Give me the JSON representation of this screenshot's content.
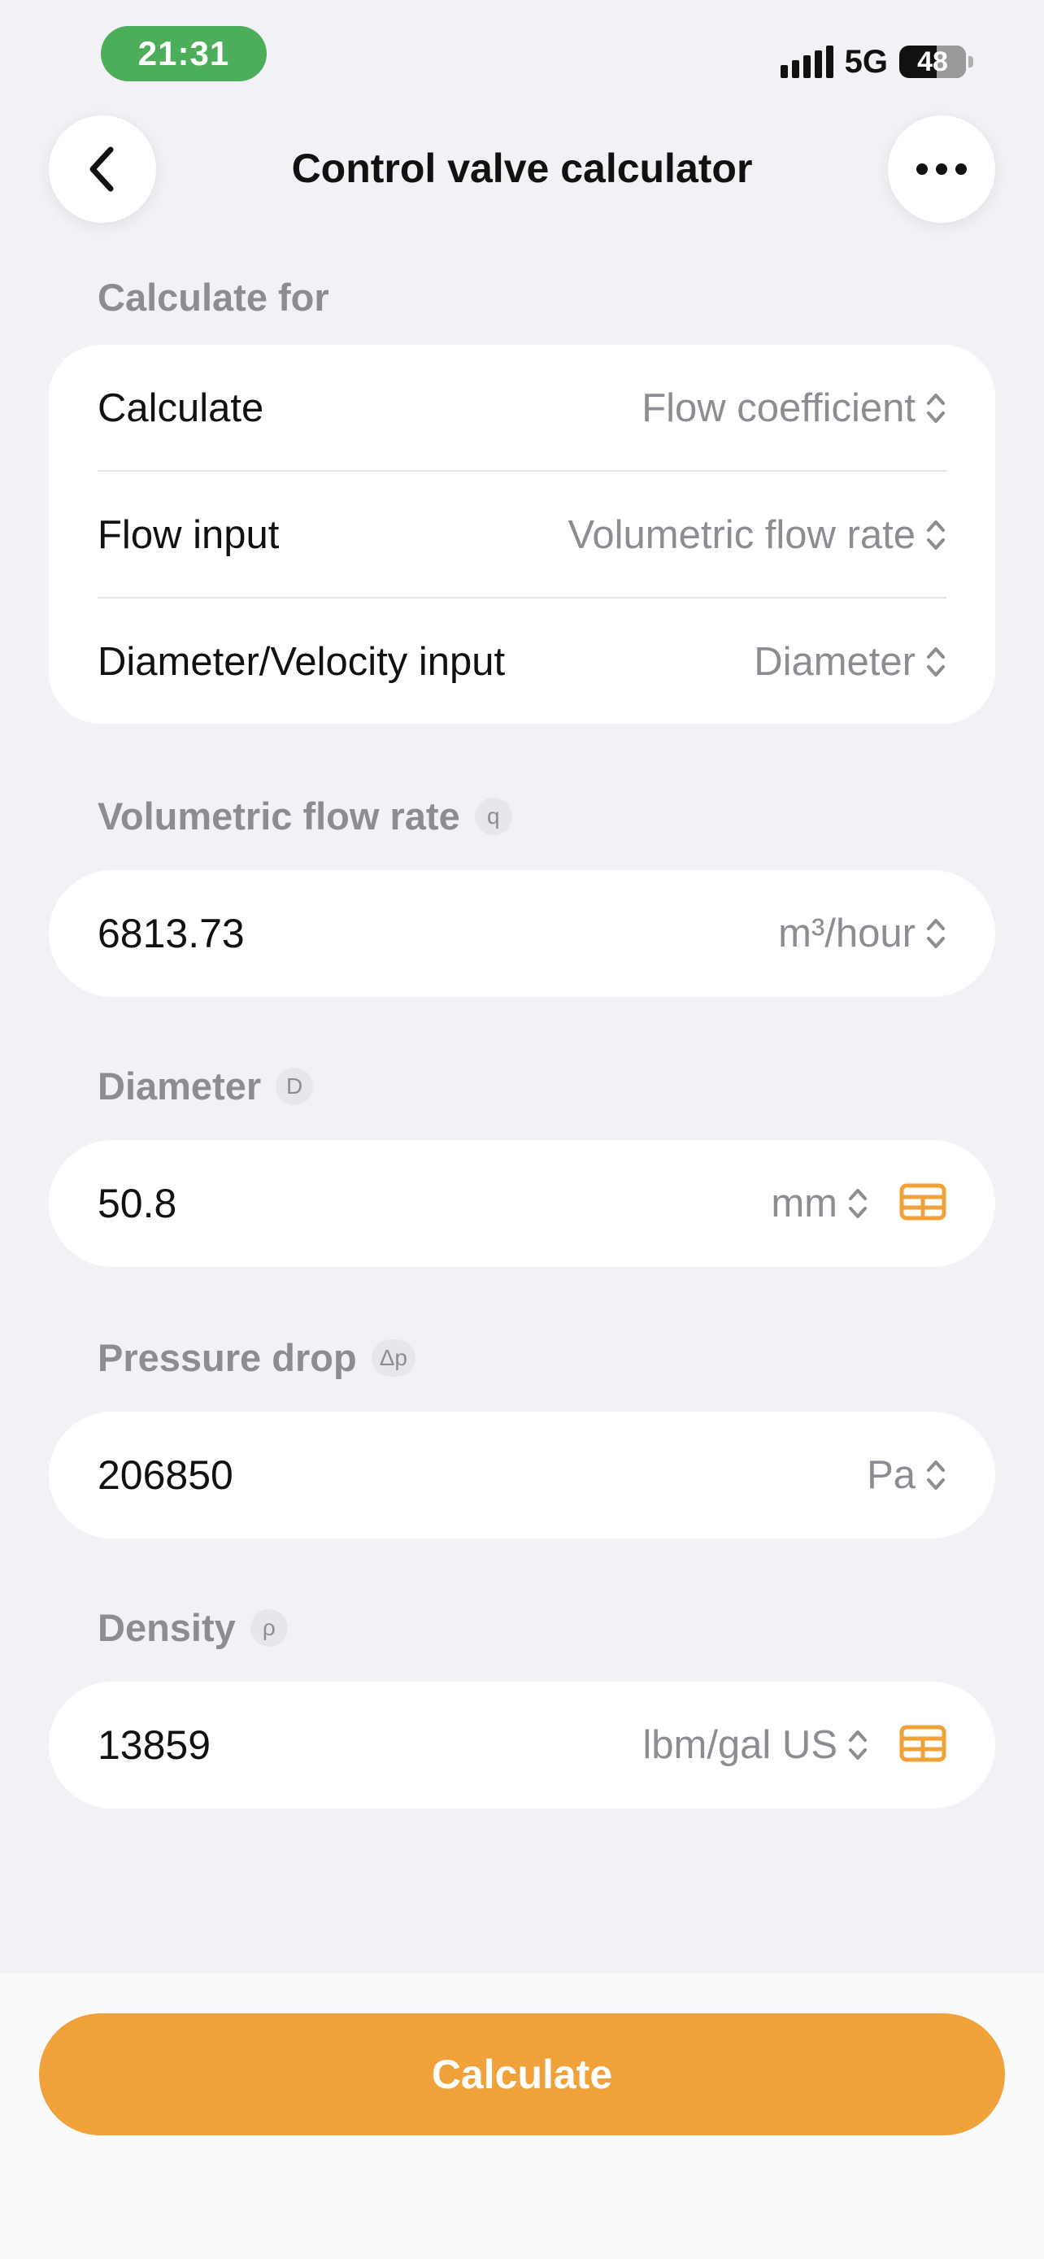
{
  "status_bar": {
    "time": "21:31",
    "network": "5G",
    "battery": "48"
  },
  "header": {
    "title": "Control valve calculator"
  },
  "calculate_for": {
    "label": "Calculate for",
    "rows": [
      {
        "label": "Calculate",
        "value": "Flow coefficient"
      },
      {
        "label": "Flow input",
        "value": "Volumetric flow rate"
      },
      {
        "label": "Diameter/Velocity input",
        "value": "Diameter"
      }
    ]
  },
  "fields": [
    {
      "label": "Volumetric flow rate",
      "symbol": "q",
      "value": "6813.73",
      "unit": "m³/hour",
      "has_table": false
    },
    {
      "label": "Diameter",
      "symbol": "D",
      "value": "50.8",
      "unit": "mm",
      "has_table": true
    },
    {
      "label": "Pressure drop",
      "symbol": "Δp",
      "value": "206850",
      "unit": "Pa",
      "has_table": false
    },
    {
      "label": "Density",
      "symbol": "ρ",
      "value": "13859",
      "unit": "lbm/gal US",
      "has_table": true
    }
  ],
  "actions": {
    "calculate_label": "Calculate"
  },
  "colors": {
    "accent": "#f1a13a",
    "status_pill": "#4cad5a",
    "background": "#f2f2f6",
    "secondary_text": "#8c8c93"
  },
  "icons": {
    "back": "chevron-left-icon",
    "more": "ellipsis-icon",
    "selector": "chevron-up-down-icon",
    "table": "table-icon"
  }
}
